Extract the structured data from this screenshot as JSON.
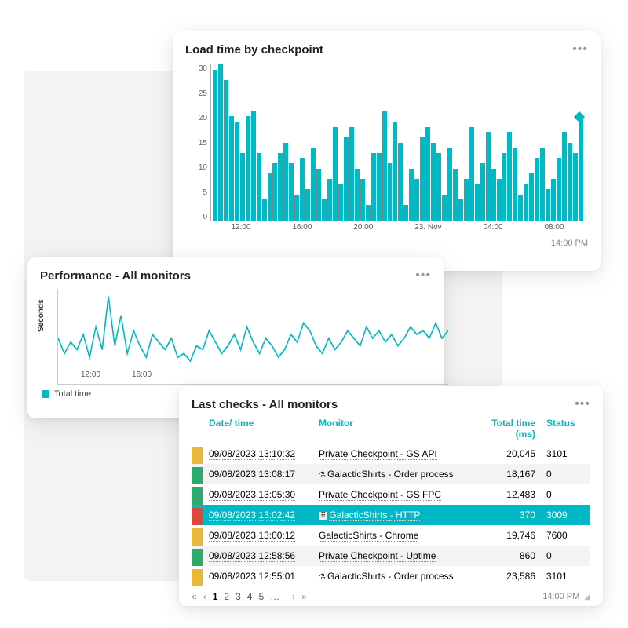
{
  "accent": "#00b9c4",
  "timestamp": "14:00 PM",
  "card1": {
    "title": "Load time by checkpoint"
  },
  "chart_data": [
    {
      "type": "bar",
      "title": "Load time by checkpoint",
      "ylabel": "",
      "ylim": [
        0,
        30
      ],
      "y_ticks": [
        30,
        25,
        20,
        15,
        10,
        5,
        0
      ],
      "x_ticks": [
        "12:00",
        "16:00",
        "20:00",
        "23. Nov",
        "04:00",
        "08:00"
      ],
      "values": [
        29,
        30,
        27,
        20,
        19,
        13,
        20,
        21,
        13,
        4,
        9,
        11,
        13,
        15,
        11,
        5,
        12,
        6,
        14,
        10,
        4,
        8,
        18,
        7,
        16,
        18,
        10,
        8,
        3,
        13,
        13,
        21,
        11,
        19,
        15,
        3,
        10,
        8,
        16,
        18,
        15,
        13,
        5,
        14,
        10,
        4,
        8,
        18,
        7,
        11,
        17,
        10,
        8,
        13,
        17,
        14,
        5,
        7,
        9,
        12,
        14,
        6,
        8,
        12,
        17,
        15,
        13,
        20
      ],
      "legend": [
        "Total time"
      ]
    },
    {
      "type": "line",
      "title": "Performance - All monitors",
      "ylabel": "Seconds",
      "x_ticks": [
        "12:00",
        "16:00"
      ],
      "values": [
        12,
        8,
        11,
        9,
        13,
        7,
        15,
        9,
        23,
        10,
        18,
        8,
        14,
        10,
        7,
        13,
        11,
        9,
        12,
        7,
        8,
        6,
        10,
        9,
        14,
        11,
        8,
        10,
        13,
        9,
        15,
        11,
        8,
        12,
        10,
        7,
        9,
        13,
        11,
        16,
        14,
        10,
        8,
        12,
        9,
        11,
        14,
        12,
        10,
        15,
        12,
        14,
        11,
        13,
        10,
        12,
        15,
        13,
        14,
        12,
        16,
        12,
        14
      ],
      "ylim": [
        0,
        25
      ],
      "legend": [
        "Total time"
      ]
    }
  ],
  "card2": {
    "title": "Performance - All monitors",
    "ylabel": "Seconds",
    "legend": "Total time"
  },
  "card3": {
    "title": "Last checks - All monitors",
    "columns": {
      "datetime": "Date/ time",
      "monitor": "Monitor",
      "total": "Total time (ms)",
      "status": "Status"
    },
    "rows": [
      {
        "color": "yellow",
        "datetime": "09/08/2023 13:10:32",
        "monitor": "Private Checkpoint - GS API",
        "icon": "",
        "total": "20,045",
        "status": "3101"
      },
      {
        "color": "green",
        "datetime": "09/08/2023 13:08:17",
        "monitor": "GalacticShirts - Order process",
        "icon": "beaker",
        "total": "18,167",
        "status": "0"
      },
      {
        "color": "green",
        "datetime": "09/08/2023 13:05:30",
        "monitor": "Private Checkpoint - GS FPC",
        "icon": "",
        "total": "12,483",
        "status": "0"
      },
      {
        "color": "red",
        "datetime": "09/08/2023 13:02:42",
        "monitor": "GalacticShirts - HTTP",
        "icon": "grip",
        "total": "370",
        "status": "3009",
        "selected": true
      },
      {
        "color": "yellow",
        "datetime": "09/08/2023 13:00:12",
        "monitor": "GalacticShirts - Chrome",
        "icon": "",
        "total": "19,746",
        "status": "7600"
      },
      {
        "color": "green",
        "datetime": "09/08/2023 12:58:56",
        "monitor": "Private Checkpoint - Uptime",
        "icon": "",
        "total": "860",
        "status": "0"
      },
      {
        "color": "yellow",
        "datetime": "09/08/2023 12:55:01",
        "monitor": "GalacticShirts - Order process",
        "icon": "beaker",
        "total": "23,586",
        "status": "3101"
      }
    ],
    "pager": {
      "first": "«",
      "prev": "‹",
      "next": "›",
      "last": "»",
      "pages": [
        "1",
        "2",
        "3",
        "4",
        "5",
        "…"
      ]
    }
  }
}
